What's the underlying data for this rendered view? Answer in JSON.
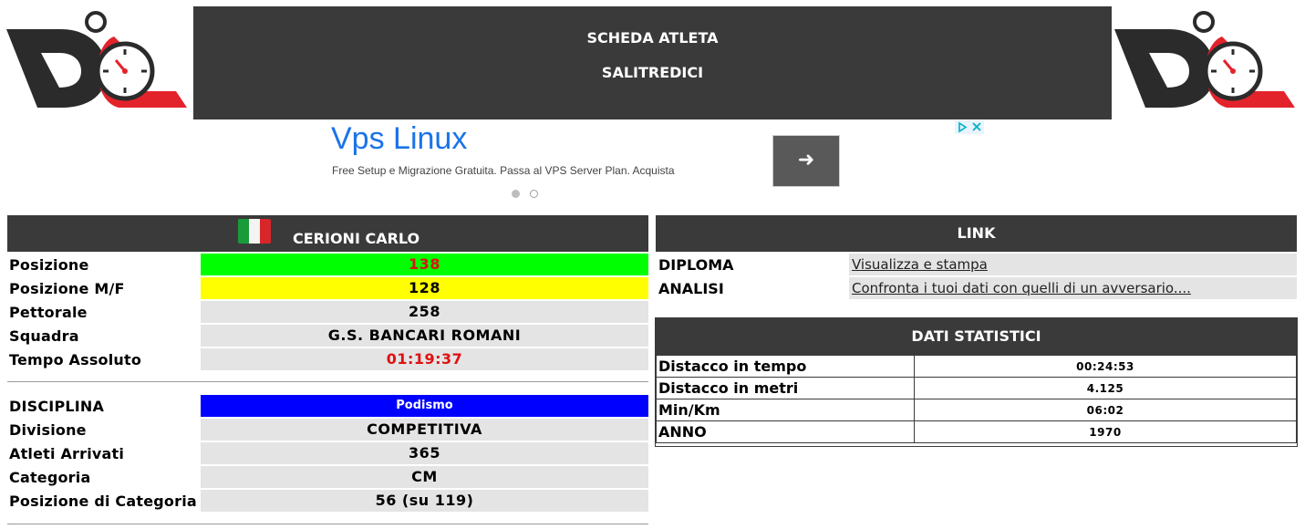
{
  "header": {
    "line1": "SCHEDA ATLETA",
    "line2": "SALITREDICI"
  },
  "ad": {
    "title": "Vps Linux",
    "description": "Free Setup e Migrazione Gratuita. Passa al VPS Server Plan. Acquista",
    "button_icon": "arrow-right-icon"
  },
  "athlete": {
    "name": "CERIONI CARLO",
    "flag_icon": "italy-flag-icon",
    "rows": [
      {
        "label": "Posizione",
        "value": "138",
        "bg": "#00ff00",
        "color": "#e01010"
      },
      {
        "label": "Posizione M/F",
        "value": "128",
        "bg": "#ffff00",
        "color": "#000000"
      },
      {
        "label": "Pettorale",
        "value": "258"
      },
      {
        "label": "Squadra",
        "value": "G.S. BANCARI ROMANI"
      },
      {
        "label": "Tempo Assoluto",
        "value": "01:19:37",
        "color": "#e01010"
      }
    ],
    "race_rows": [
      {
        "label": "DISCIPLINA",
        "value": "Podismo",
        "bg": "#0000ff",
        "color": "#ffffff"
      },
      {
        "label": "Divisione",
        "value": "COMPETITIVA"
      },
      {
        "label": "Atleti Arrivati",
        "value": "365"
      },
      {
        "label": "Categoria",
        "value": "CM"
      },
      {
        "label": "Posizione di Categoria",
        "value": "56 (su 119)"
      }
    ]
  },
  "links": {
    "title": "LINK",
    "rows": [
      {
        "label": "DIPLOMA",
        "value": "Visualizza e stampa"
      },
      {
        "label": "ANALISI",
        "value": "Confronta i tuoi dati con quelli di un avversario...."
      }
    ]
  },
  "stats": {
    "title": "DATI STATISTICI",
    "rows": [
      {
        "label": "Distacco in tempo",
        "value": "00:24:53"
      },
      {
        "label": "Distacco in metri",
        "value": "4.125"
      },
      {
        "label": "Min/Km",
        "value": "06:02"
      },
      {
        "label": "ANNO",
        "value": "1970"
      }
    ]
  }
}
